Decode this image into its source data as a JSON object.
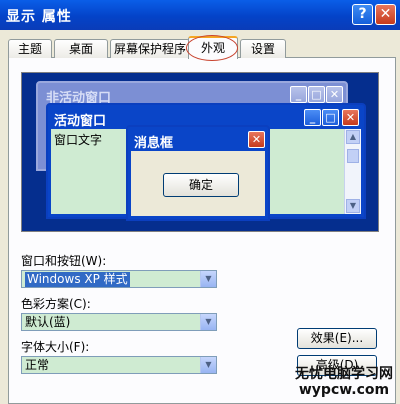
{
  "window": {
    "title": "显示 属性",
    "help_label": "?",
    "close_label": "✕"
  },
  "tabs": [
    {
      "label": "主题"
    },
    {
      "label": "桌面"
    },
    {
      "label": "屏幕保护程序"
    },
    {
      "label": "外观",
      "active": true
    },
    {
      "label": "设置"
    }
  ],
  "preview": {
    "inactive_title": "非活动窗口",
    "active_title": "活动窗口",
    "window_text": "窗口文字",
    "message_title": "消息框",
    "ok_label": "确定"
  },
  "controls": {
    "windows_buttons": {
      "label": "窗口和按钮(W):",
      "value": "Windows XP 样式"
    },
    "color_scheme": {
      "label": "色彩方案(C):",
      "value": "默认(蓝)"
    },
    "font_size": {
      "label": "字体大小(F):",
      "value": "正常"
    },
    "effects_label": "效果(E)...",
    "advanced_label": "高级(D)"
  },
  "watermark": {
    "line1": "无忧电脑学习网",
    "line2": "wypcw.com"
  },
  "colors": {
    "title_bar": "#0443C8",
    "preview_bg": "#052E8E",
    "window_body": "#CFEBD2",
    "tab_highlight": "#F5A623"
  }
}
